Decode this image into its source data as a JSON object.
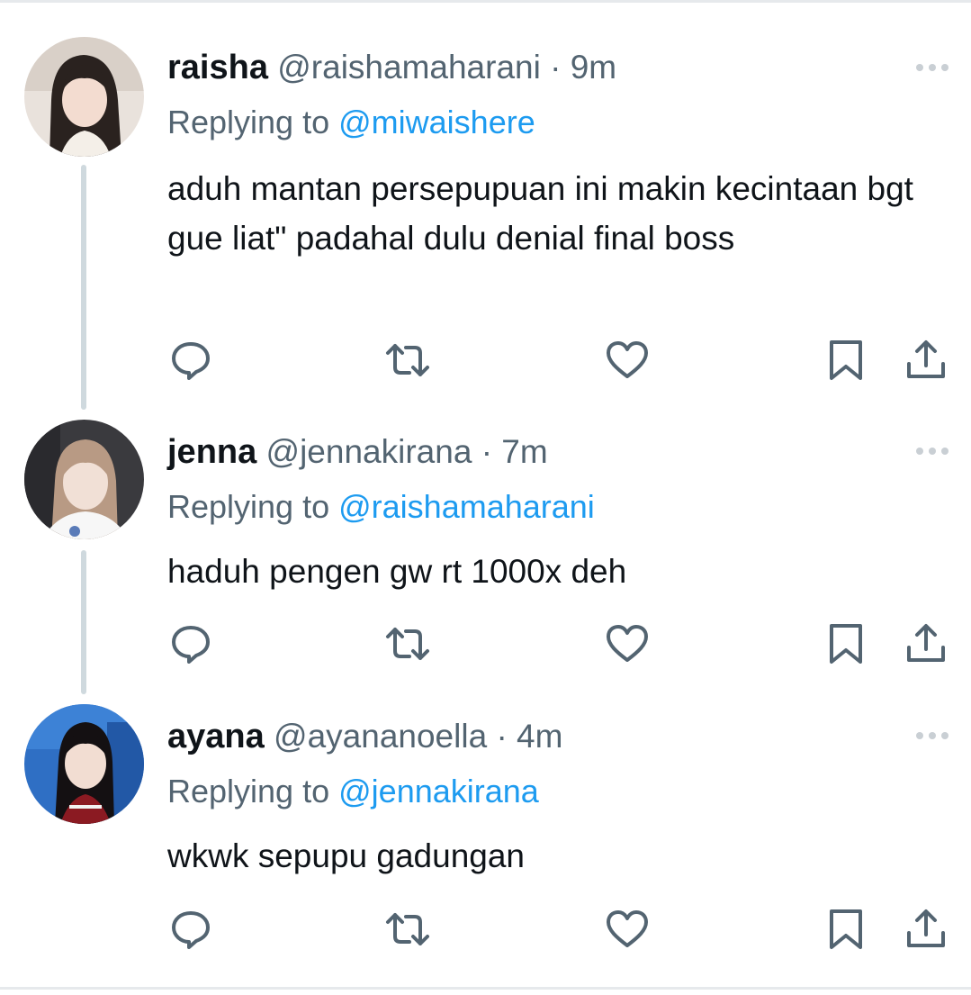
{
  "tweets": [
    {
      "display_name": "raisha",
      "handle": "@raishamaharani",
      "separator": "·",
      "time": "9m",
      "replying_prefix": "Replying to",
      "replying_to": "@miwaishere",
      "text": "aduh mantan persepupuan ini makin kecintaan bgt gue liat\" padahal dulu denial final boss",
      "avatar_icon": "avatar-photo"
    },
    {
      "display_name": "jenna",
      "handle": "@jennakirana",
      "separator": "·",
      "time": "7m",
      "replying_prefix": "Replying to",
      "replying_to": "@raishamaharani",
      "text": "haduh pengen gw rt 1000x deh",
      "avatar_icon": "avatar-photo"
    },
    {
      "display_name": "ayana",
      "handle": "@ayananoella",
      "separator": "·",
      "time": "4m",
      "replying_prefix": "Replying to",
      "replying_to": "@jennakirana",
      "text": "wkwk sepupu gadungan",
      "avatar_icon": "avatar-photo"
    }
  ],
  "icons": {
    "reply": "reply-icon",
    "retweet": "retweet-icon",
    "like": "like-icon",
    "bookmark": "bookmark-icon",
    "share": "share-icon",
    "more": "more-icon"
  },
  "colors": {
    "accent": "#1d9bf0",
    "secondary_text": "#536471",
    "primary_text": "#0f1419",
    "icon": "#536471",
    "thread_line": "#cfd9de"
  }
}
